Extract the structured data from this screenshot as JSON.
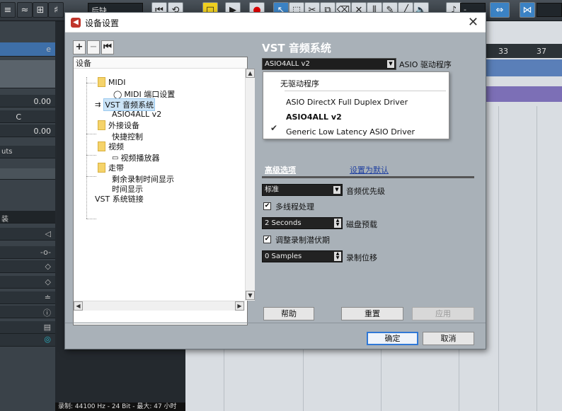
{
  "daw": {
    "toolbar_select": "后缺",
    "inspector_values": [
      "0.00",
      "C",
      "0.00"
    ],
    "inspector_label": "uts",
    "inspector_tag": "装",
    "ruler": [
      "33",
      "37"
    ],
    "status": "录制: 44100 Hz - 24 Bit - 最大: 47 小时"
  },
  "dialog": {
    "title": "设备设置",
    "close": "✕",
    "tree_toolbar": [
      "+",
      "−",
      "⏮"
    ],
    "tree_header": "设备",
    "tree": [
      {
        "label": "MIDI"
      },
      {
        "label": "MIDI 端口设置"
      },
      {
        "label": "VST 音频系统"
      },
      {
        "label": "ASIO4ALL v2"
      },
      {
        "label": "外接设备"
      },
      {
        "label": "快捷控制"
      },
      {
        "label": "视频"
      },
      {
        "label": "视频播放器"
      },
      {
        "label": "走带"
      },
      {
        "label": "剩余录制时间显示"
      },
      {
        "label": "时间显示"
      },
      {
        "label": "VST 系统链接"
      }
    ],
    "section_title": "VST 音频系统",
    "driver_select": "ASIO4ALL v2",
    "driver_label": "ASIO 驱动程序",
    "dropdown": {
      "options": [
        "无驱动程序",
        "ASIO DirectX Full Duplex Driver",
        "ASIO4ALL v2",
        "Generic Low Latency ASIO Driver"
      ],
      "selected": "ASIO4ALL v2"
    },
    "tabs": {
      "advanced": "高级选项",
      "default": "设置为默认"
    },
    "audio_priority": {
      "value": "标准",
      "label": "音频优先级"
    },
    "multithread": {
      "label": "多线程处理",
      "checked": true
    },
    "disk_preload": {
      "value": "2 Seconds",
      "label": "磁盘预载"
    },
    "adjust_latency": {
      "label": "调整录制潜伏期",
      "checked": true
    },
    "record_offset": {
      "value": "0 Samples",
      "label": "录制位移"
    },
    "buttons": {
      "help": "帮助",
      "reset": "重置",
      "apply": "应用",
      "ok": "确定",
      "cancel": "取消"
    }
  }
}
